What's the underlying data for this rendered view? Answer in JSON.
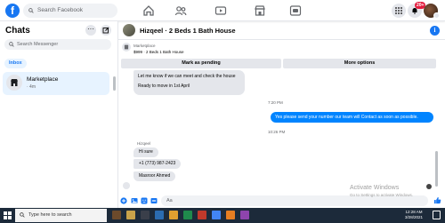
{
  "topbar": {
    "logo_letter": "f",
    "search_placeholder": "Search Facebook",
    "notification_badge": "20+",
    "nav": [
      "home-icon",
      "friends-icon",
      "watch-icon",
      "marketplace-icon",
      "gaming-icon"
    ],
    "accent": "#1877f2"
  },
  "sidebar": {
    "title": "Chats",
    "more_label": "···",
    "search_placeholder": "Search Messenger",
    "filter": "Inbox",
    "conversation": {
      "name": "Marketplace",
      "time": "· 4m"
    }
  },
  "conversation": {
    "title": "Hizqeel · 2 Beds 1 Bath House",
    "listing_label": "Marketplace",
    "listing_desc": "$999 · 2 Beds 1 Bath House",
    "buttons": {
      "pending": "Mark as pending",
      "options": "More options"
    },
    "messages": {
      "first_line1": "Let me know if we can meet and check the house",
      "first_line2": "Ready to move in 1st April",
      "time1": "7:20 PM",
      "outgoing": "Yes  please send your number our team will Contact as soon as possible.",
      "time2": "10:26 PM",
      "sender": "Hizqeel",
      "reply1": "Hi sure",
      "reply2": "+1 (773) 987-2423",
      "reply3": "Masroor Ahmed"
    },
    "outgoing_color": "#0084ff",
    "composer_placeholder": "Aa"
  },
  "watermark": {
    "line1": "Activate Windows",
    "line2": "Go to Settings to activate Windows."
  },
  "taskbar": {
    "search_placeholder": "Type here to search",
    "time": "12:28 AM",
    "date": "3/28/2021"
  }
}
